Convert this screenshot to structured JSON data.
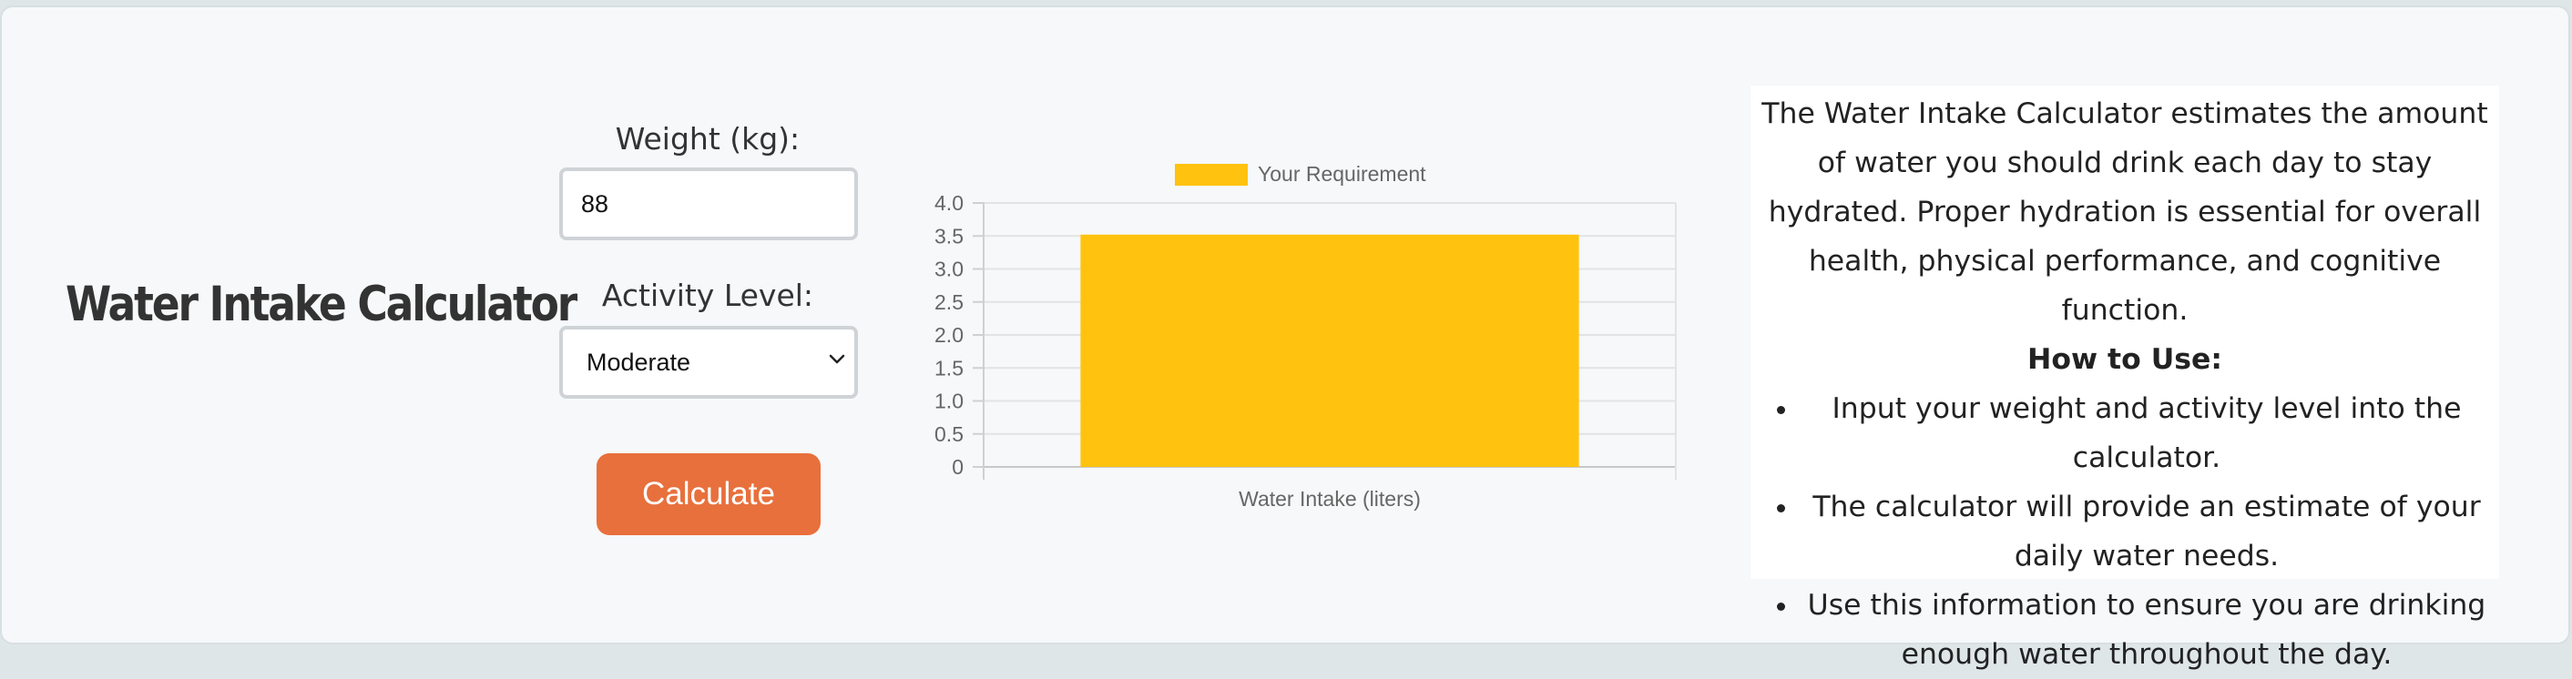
{
  "app": {
    "title": "Water Intake Calculator"
  },
  "form": {
    "weight_label": "Weight (kg):",
    "weight_value": "88",
    "activity_label": "Activity Level:",
    "activity_selected": "Moderate",
    "calculate_label": "Calculate"
  },
  "colors": {
    "button": "#e8703c",
    "bar": "#ffc20e",
    "background": "#f6f8f9"
  },
  "chart_data": {
    "type": "bar",
    "categories": [
      "Water Intake (liters)"
    ],
    "series": [
      {
        "name": "Your Requirement",
        "values": [
          3.52
        ],
        "color": "#ffc20e"
      }
    ],
    "title": "",
    "xlabel": "",
    "ylabel": "",
    "ylim": [
      0,
      4.0
    ],
    "yticks": [
      "0",
      "0.5",
      "1.0",
      "1.5",
      "2.0",
      "2.5",
      "3.0",
      "3.5",
      "4.0"
    ],
    "grid": true,
    "legend": "top-center"
  },
  "info": {
    "description": "The Water Intake Calculator estimates the amount of water you should drink each day to stay hydrated. Proper hydration is essential for overall health, physical performance, and cognitive function.",
    "how_to_title": "How to Use:",
    "steps": [
      "Input your weight and activity level into the calculator.",
      "The calculator will provide an estimate of your daily water needs.",
      "Use this information to ensure you are drinking enough water throughout the day."
    ]
  }
}
